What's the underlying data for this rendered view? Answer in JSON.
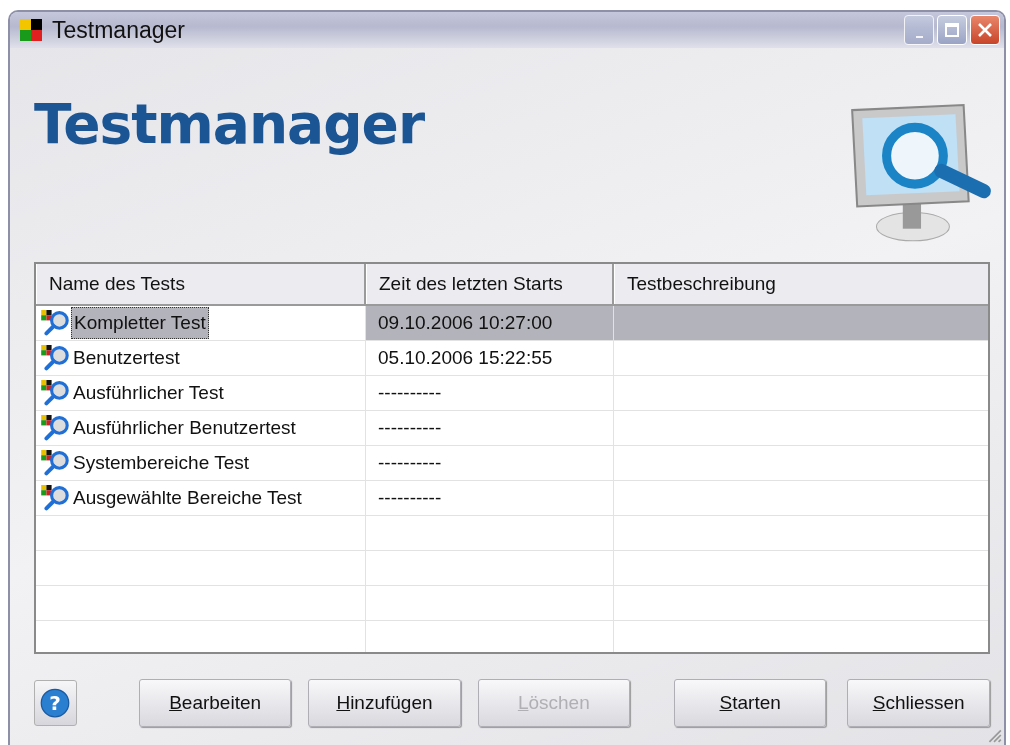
{
  "window": {
    "title": "Testmanager"
  },
  "heading": "Testmanager",
  "table": {
    "columns": [
      "Name des Tests",
      "Zeit des letzten Starts",
      "Testbeschreibung"
    ],
    "rows": [
      {
        "name": "Kompletter Test",
        "last_start": "09.10.2006 10:27:00",
        "selected": true
      },
      {
        "name": "Benutzertest",
        "last_start": "05.10.2006 15:22:55",
        "selected": false
      },
      {
        "name": "Ausführlicher Test",
        "last_start": "----------",
        "selected": false
      },
      {
        "name": "Ausführlicher Benutzertest",
        "last_start": "----------",
        "selected": false
      },
      {
        "name": "Systembereiche Test",
        "last_start": "----------",
        "selected": false
      },
      {
        "name": "Ausgewählte Bereiche Test",
        "last_start": "----------",
        "selected": false
      }
    ]
  },
  "help_button": {
    "glyph": "?"
  },
  "buttons": [
    {
      "label": "Bearbeiten",
      "disabled": false
    },
    {
      "label": "Hinzufügen",
      "disabled": false
    },
    {
      "label": "Löschen",
      "disabled": true
    },
    {
      "label": "Starten",
      "disabled": false
    },
    {
      "label": "Schliessen",
      "disabled": false
    }
  ]
}
